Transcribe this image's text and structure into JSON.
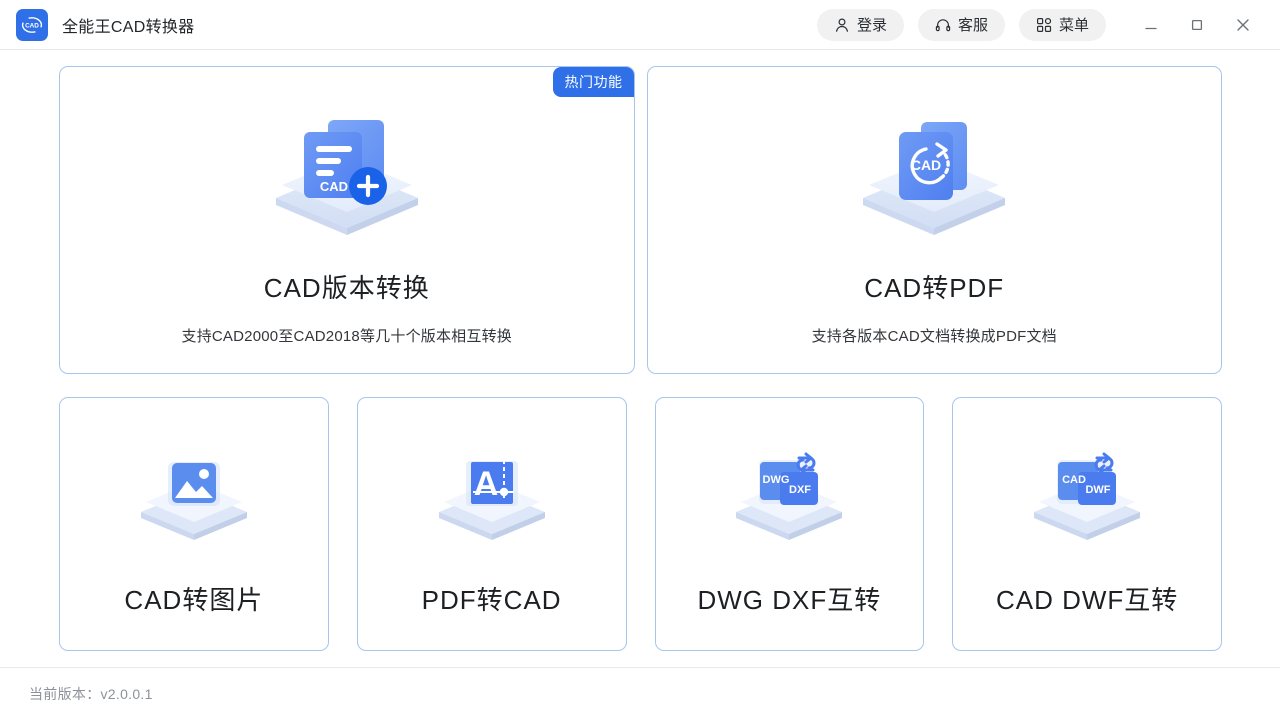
{
  "window": {
    "app_icon_label": "CAD",
    "title": "全能王CAD转换器",
    "actions": [
      {
        "name": "login",
        "label": "登录",
        "icon": "user-icon"
      },
      {
        "name": "support",
        "label": "客服",
        "icon": "headset-icon"
      },
      {
        "name": "menu",
        "label": "菜单",
        "icon": "grid-menu-icon"
      }
    ],
    "controls": [
      {
        "name": "minimize",
        "icon": "minimize-icon"
      },
      {
        "name": "maximize",
        "icon": "maximize-icon"
      },
      {
        "name": "close",
        "icon": "close-icon"
      }
    ]
  },
  "colors": {
    "accent": "#2f70e8",
    "card_border": "#a8c6ec",
    "icon_blue": "#5b8def",
    "icon_blue_dark": "#4a7cf0",
    "pill_bg": "#f1f1f2",
    "title_text": "#1d2023",
    "sub_text": "#33373b",
    "footer_text": "#8d9299",
    "divider": "#e6e8eb"
  },
  "cards_top": [
    {
      "id": "cad-version-convert",
      "title": "CAD版本转换",
      "subtitle": "支持CAD2000至CAD2018等几十个版本相互转换",
      "badge": "热门功能",
      "icon": "cad-document-plus-icon",
      "icon_text": "CAD"
    },
    {
      "id": "cad-to-pdf",
      "title": "CAD转PDF",
      "subtitle": "支持各版本CAD文档转换成PDF文档",
      "badge": "",
      "icon": "cad-refresh-document-icon",
      "icon_text": "CAD"
    }
  ],
  "cards_bottom": [
    {
      "id": "cad-to-image",
      "title": "CAD转图片",
      "icon": "picture-icon",
      "icon_text": ""
    },
    {
      "id": "pdf-to-cad",
      "title": "PDF转CAD",
      "icon": "letter-a-crosshair-icon",
      "icon_text": "A"
    },
    {
      "id": "dwg-dxf-swap",
      "title": "DWG DXF互转",
      "icon": "two-files-swap-icon",
      "icon_text_left": "DWG",
      "icon_text_right": "DXF"
    },
    {
      "id": "cad-dwf-swap",
      "title": "CAD DWF互转",
      "icon": "two-files-swap-icon",
      "icon_text_left": "CAD",
      "icon_text_right": "DWF"
    }
  ],
  "footer": {
    "version_text": "当前版本：v2.0.0.1"
  }
}
